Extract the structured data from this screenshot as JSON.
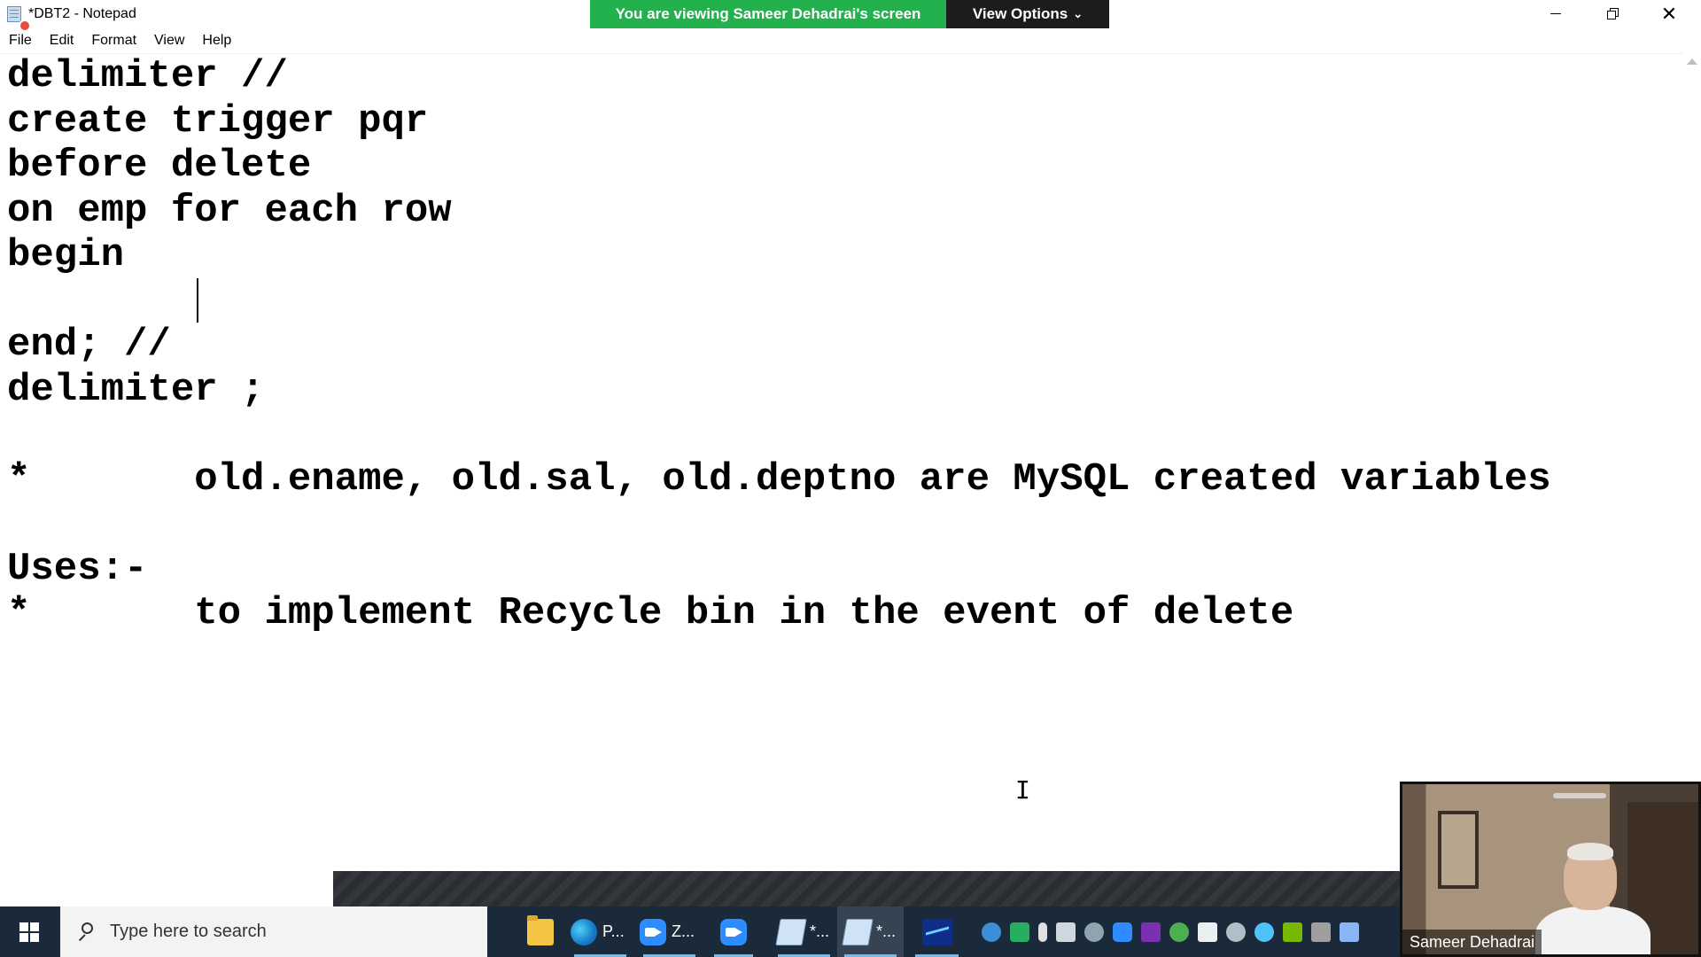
{
  "window": {
    "title": "*DBT2 - Notepad",
    "minimize_icon": "minimize-icon",
    "restore_icon": "restore-icon",
    "close_icon": "close-icon"
  },
  "share_banner": {
    "message": "You are viewing Sameer Dehadrai's screen",
    "options_label": "View Options",
    "colors": {
      "message_bg": "#23b14d",
      "options_bg": "#1c1c1c"
    }
  },
  "menu": {
    "items": [
      "File",
      "Edit",
      "Format",
      "View",
      "Help"
    ]
  },
  "editor": {
    "lines": [
      "delimiter //",
      "create trigger pqr",
      "before delete",
      "on emp for each row",
      "begin",
      "",
      "end; //",
      "delimiter ;",
      "",
      "*       old.ename, old.sal, old.deptno are MySQL created variables",
      "",
      "Uses:-",
      "*       to implement Recycle bin in the event of delete"
    ]
  },
  "taskbar": {
    "search_placeholder": "Type here to search",
    "apps": [
      {
        "icon": "file-explorer-icon",
        "label": ""
      },
      {
        "icon": "edge-icon",
        "label": "P..."
      },
      {
        "icon": "zoom-icon",
        "label": "Z..."
      },
      {
        "icon": "zoom-meeting-icon",
        "label": ""
      },
      {
        "icon": "notepad-icon",
        "label": "*..."
      },
      {
        "icon": "notepad-icon",
        "label": "*..."
      },
      {
        "icon": "stock-chart-icon",
        "label": ""
      }
    ],
    "background": "#1b2a3b"
  },
  "webcam": {
    "participant_name": "Sameer Dehadrai"
  }
}
